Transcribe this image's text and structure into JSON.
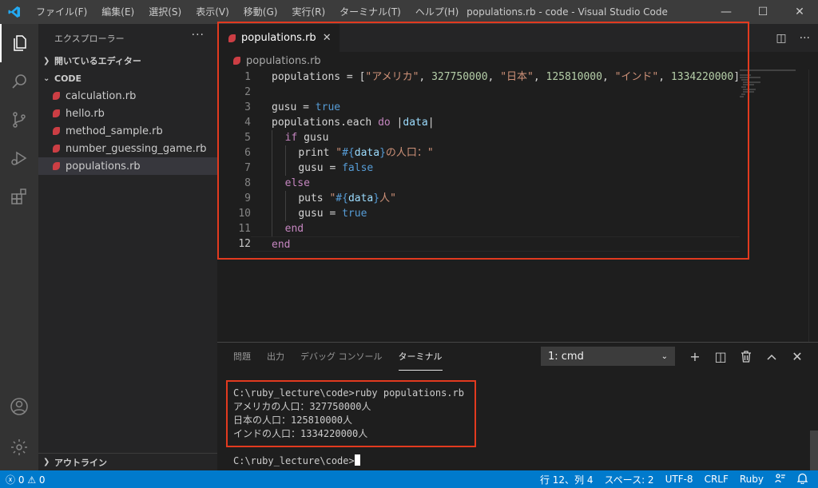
{
  "app": {
    "window_title": "populations.rb - code - Visual Studio Code",
    "accent_color": "#007acc"
  },
  "menu": [
    "ファイル(F)",
    "編集(E)",
    "選択(S)",
    "表示(V)",
    "移動(G)",
    "実行(R)",
    "ターミナル(T)",
    "ヘルプ(H)"
  ],
  "window_controls": {
    "minimize": "—",
    "maximize": "☐",
    "close": "✕"
  },
  "sidebar": {
    "title": "エクスプローラー",
    "more": "···",
    "open_editors": "開いているエディター",
    "folder": "CODE",
    "files": [
      "calculation.rb",
      "hello.rb",
      "method_sample.rb",
      "number_guessing_game.rb",
      "populations.rb"
    ],
    "selected_file": "populations.rb",
    "outline": "アウトライン"
  },
  "editor": {
    "tab": "populations.rb",
    "breadcrumb": "populations.rb",
    "line_numbers": [
      "1",
      "2",
      "3",
      "4",
      "5",
      "6",
      "7",
      "8",
      "9",
      "10",
      "11",
      "12"
    ]
  },
  "code": {
    "l1_a": "populations = [",
    "l1_s1": "\"アメリカ\"",
    "l1_c1": ", ",
    "l1_n1": "327750000",
    "l1_c2": ", ",
    "l1_s2": "\"日本\"",
    "l1_c3": ", ",
    "l1_n2": "125810000",
    "l1_c4": ", ",
    "l1_s3": "\"インド\"",
    "l1_c5": ", ",
    "l1_n3": "1334220000",
    "l1_end": "]",
    "l3_a": "gusu = ",
    "l3_b": "true",
    "l4_a": "populations.each ",
    "l4_k": "do",
    "l4_b": " |",
    "l4_v": "data",
    "l4_c": "|",
    "l5_k": "if",
    "l5_a": " gusu",
    "l6_a": "print ",
    "l6_s1": "\"",
    "l6_i": "#{",
    "l6_v": "data",
    "l6_i2": "}",
    "l6_s2": "の人口：\"",
    "l7_a": "gusu = ",
    "l7_b": "false",
    "l8_k": "else",
    "l9_a": "puts ",
    "l9_s1": "\"",
    "l9_i": "#{",
    "l9_v": "data",
    "l9_i2": "}",
    "l9_s2": "人\"",
    "l10_a": "gusu = ",
    "l10_b": "true",
    "l11_k": "end",
    "l12_k": "end"
  },
  "panel": {
    "tabs": [
      "問題",
      "出力",
      "デバッグ コンソール",
      "ターミナル"
    ],
    "active_tab": "ターミナル",
    "terminal_select": "1: cmd",
    "actions": {
      "add": "+",
      "split": "◫",
      "trash": "🗑",
      "maximize": "︿",
      "close": "✕"
    },
    "terminal_lines": [
      "C:\\ruby_lecture\\code>ruby populations.rb",
      "アメリカの人口：327750000人",
      "日本の人口：125810000人",
      "インドの人口：1334220000人",
      "",
      "C:\\ruby_lecture\\code>"
    ]
  },
  "statusbar": {
    "errors": "0",
    "warnings": "0",
    "position": "行 12、列 4",
    "spaces": "スペース: 2",
    "encoding": "UTF-8",
    "eol": "CRLF",
    "language": "Ruby"
  },
  "highlight_color": "#e23a1f"
}
